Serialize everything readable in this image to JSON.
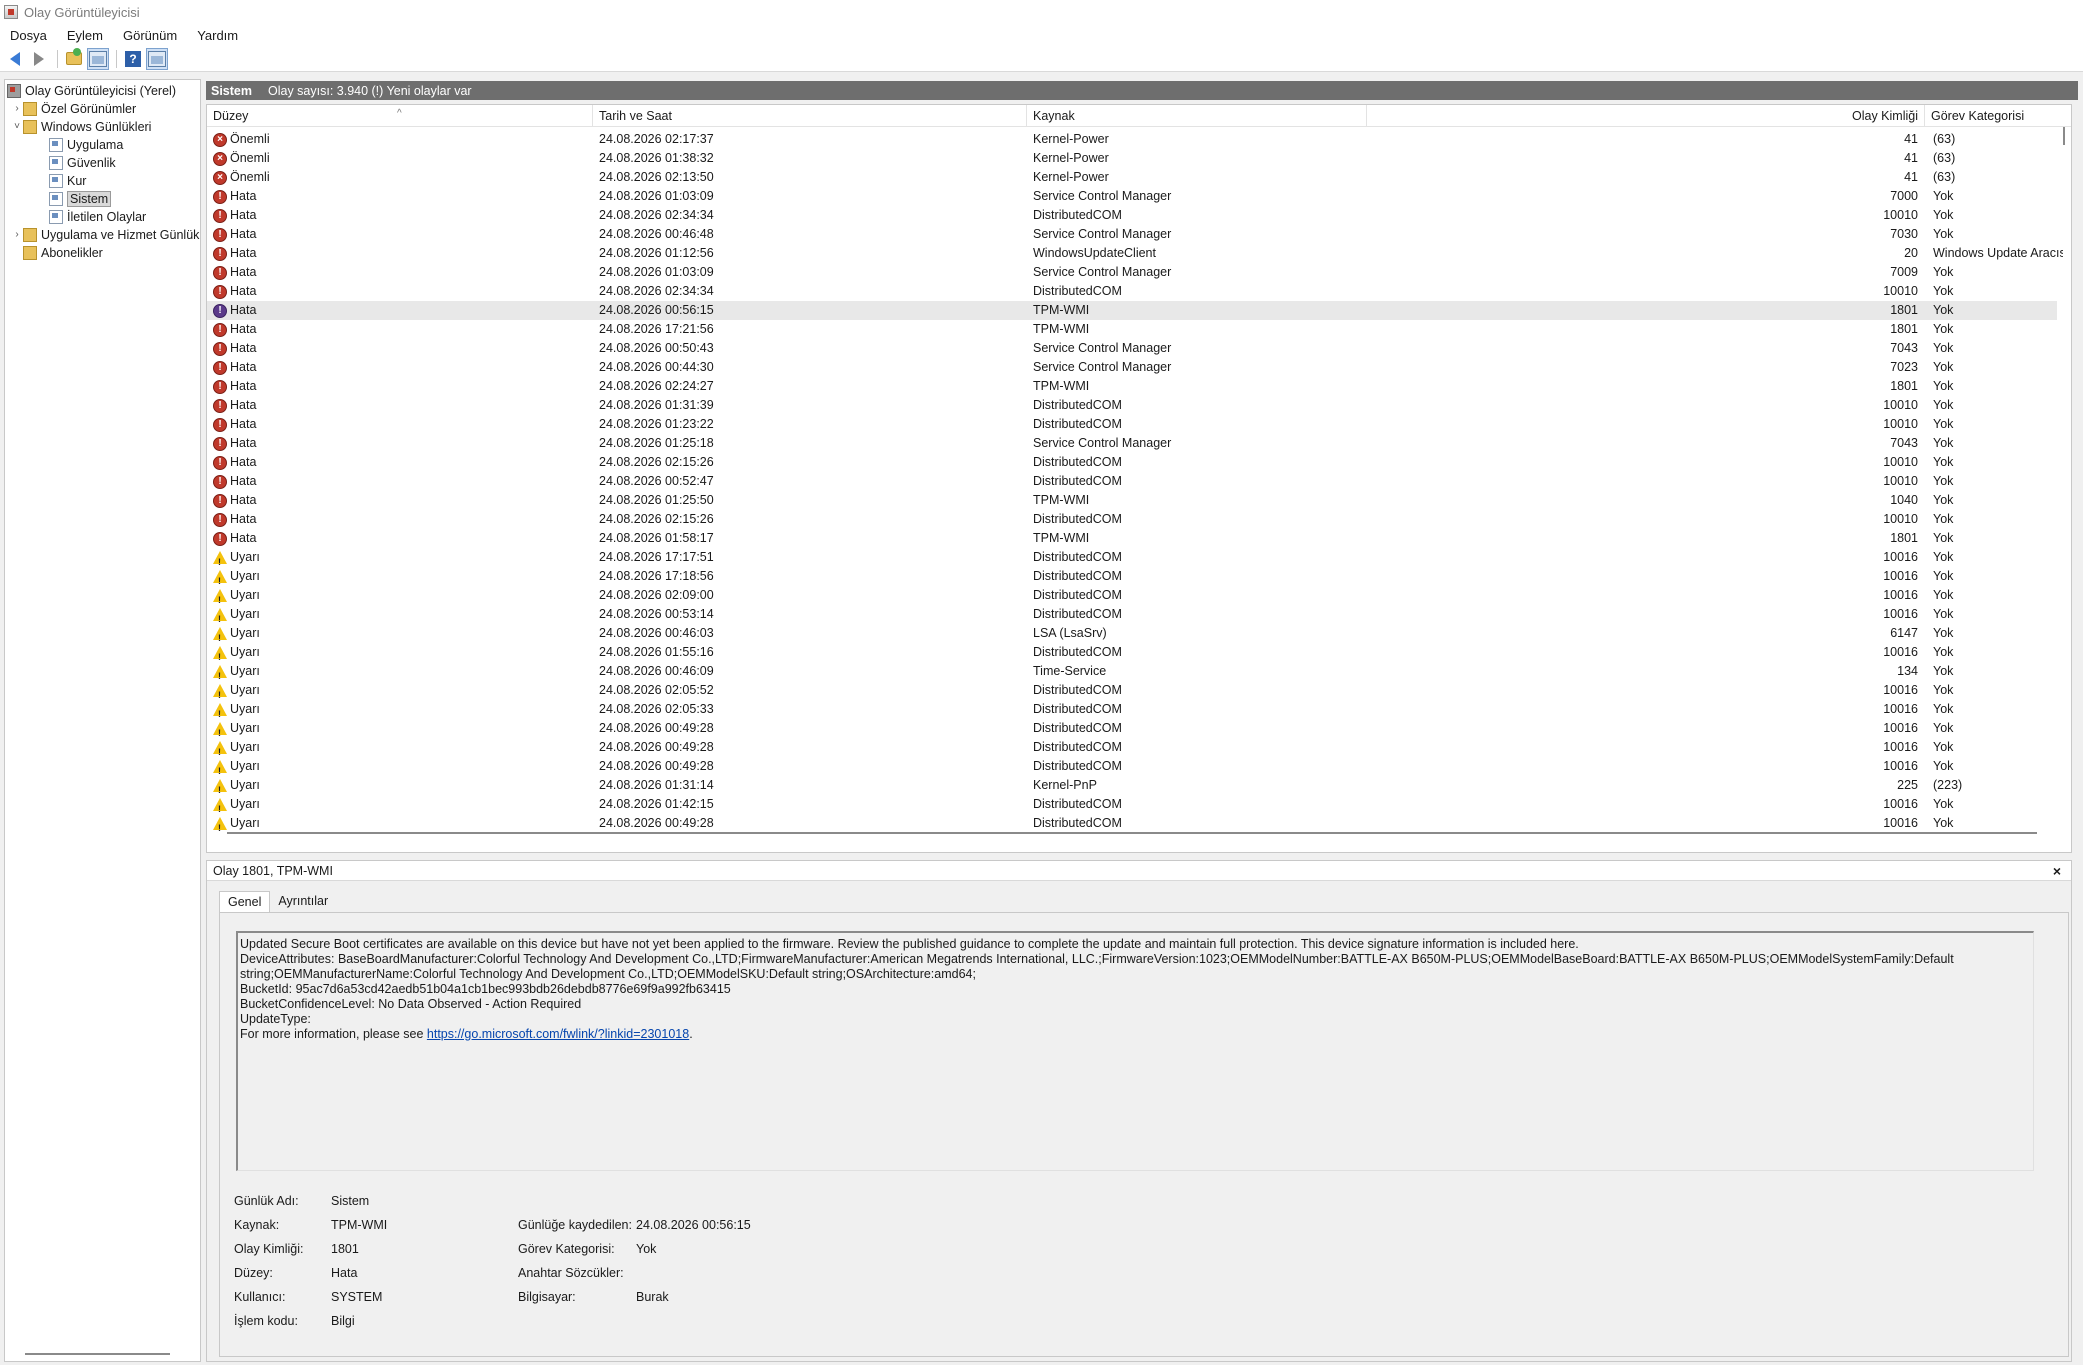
{
  "window": {
    "title": "Olay Görüntüleyicisi"
  },
  "menu": [
    "Dosya",
    "Eylem",
    "Görünüm",
    "Yardım"
  ],
  "tree": {
    "root": "Olay Görüntüleyicisi (Yerel)",
    "custom_views": "Özel Görünümler",
    "windows_logs": "Windows Günlükleri",
    "app": "Uygulama",
    "security": "Güvenlik",
    "setup": "Kur",
    "system": "Sistem",
    "forwarded": "İletilen Olaylar",
    "app_service": "Uygulama ve Hizmet Günlük",
    "subscriptions": "Abonelikler"
  },
  "main": {
    "title": "Sistem",
    "subtitle": "Olay sayısı: 3.940 (!) Yeni olaylar var",
    "columns": {
      "level": "Düzey",
      "date": "Tarih ve Saat",
      "source": "Kaynak",
      "id": "Olay Kimliği",
      "category": "Görev Kategorisi"
    }
  },
  "events": [
    {
      "level": "Önemli",
      "type": "critical",
      "date": "24.08.2026 02:17:37",
      "source": "Kernel-Power",
      "id": "41",
      "category": "(63)"
    },
    {
      "level": "Önemli",
      "type": "critical",
      "date": "24.08.2026 01:38:32",
      "source": "Kernel-Power",
      "id": "41",
      "category": "(63)"
    },
    {
      "level": "Önemli",
      "type": "critical",
      "date": "24.08.2026 02:13:50",
      "source": "Kernel-Power",
      "id": "41",
      "category": "(63)"
    },
    {
      "level": "Hata",
      "type": "error",
      "date": "24.08.2026 01:03:09",
      "source": "Service Control Manager",
      "id": "7000",
      "category": "Yok"
    },
    {
      "level": "Hata",
      "type": "error",
      "date": "24.08.2026 02:34:34",
      "source": "DistributedCOM",
      "id": "10010",
      "category": "Yok"
    },
    {
      "level": "Hata",
      "type": "error",
      "date": "24.08.2026 00:46:48",
      "source": "Service Control Manager",
      "id": "7030",
      "category": "Yok"
    },
    {
      "level": "Hata",
      "type": "error",
      "date": "24.08.2026 01:12:56",
      "source": "WindowsUpdateClient",
      "id": "20",
      "category": "Windows Update Aracısı"
    },
    {
      "level": "Hata",
      "type": "error",
      "date": "24.08.2026 01:03:09",
      "source": "Service Control Manager",
      "id": "7009",
      "category": "Yok"
    },
    {
      "level": "Hata",
      "type": "error",
      "date": "24.08.2026 02:34:34",
      "source": "DistributedCOM",
      "id": "10010",
      "category": "Yok"
    },
    {
      "level": "Hata",
      "type": "error",
      "date": "24.08.2026 00:56:15",
      "source": "TPM-WMI",
      "id": "1801",
      "category": "Yok",
      "selected": true
    },
    {
      "level": "Hata",
      "type": "error",
      "date": "24.08.2026 17:21:56",
      "source": "TPM-WMI",
      "id": "1801",
      "category": "Yok"
    },
    {
      "level": "Hata",
      "type": "error",
      "date": "24.08.2026 00:50:43",
      "source": "Service Control Manager",
      "id": "7043",
      "category": "Yok"
    },
    {
      "level": "Hata",
      "type": "error",
      "date": "24.08.2026 00:44:30",
      "source": "Service Control Manager",
      "id": "7023",
      "category": "Yok"
    },
    {
      "level": "Hata",
      "type": "error",
      "date": "24.08.2026 02:24:27",
      "source": "TPM-WMI",
      "id": "1801",
      "category": "Yok"
    },
    {
      "level": "Hata",
      "type": "error",
      "date": "24.08.2026 01:31:39",
      "source": "DistributedCOM",
      "id": "10010",
      "category": "Yok"
    },
    {
      "level": "Hata",
      "type": "error",
      "date": "24.08.2026 01:23:22",
      "source": "DistributedCOM",
      "id": "10010",
      "category": "Yok"
    },
    {
      "level": "Hata",
      "type": "error",
      "date": "24.08.2026 01:25:18",
      "source": "Service Control Manager",
      "id": "7043",
      "category": "Yok"
    },
    {
      "level": "Hata",
      "type": "error",
      "date": "24.08.2026 02:15:26",
      "source": "DistributedCOM",
      "id": "10010",
      "category": "Yok"
    },
    {
      "level": "Hata",
      "type": "error",
      "date": "24.08.2026 00:52:47",
      "source": "DistributedCOM",
      "id": "10010",
      "category": "Yok"
    },
    {
      "level": "Hata",
      "type": "error",
      "date": "24.08.2026 01:25:50",
      "source": "TPM-WMI",
      "id": "1040",
      "category": "Yok"
    },
    {
      "level": "Hata",
      "type": "error",
      "date": "24.08.2026 02:15:26",
      "source": "DistributedCOM",
      "id": "10010",
      "category": "Yok"
    },
    {
      "level": "Hata",
      "type": "error",
      "date": "24.08.2026 01:58:17",
      "source": "TPM-WMI",
      "id": "1801",
      "category": "Yok"
    },
    {
      "level": "Uyarı",
      "type": "warning",
      "date": "24.08.2026 17:17:51",
      "source": "DistributedCOM",
      "id": "10016",
      "category": "Yok"
    },
    {
      "level": "Uyarı",
      "type": "warning",
      "date": "24.08.2026 17:18:56",
      "source": "DistributedCOM",
      "id": "10016",
      "category": "Yok"
    },
    {
      "level": "Uyarı",
      "type": "warning",
      "date": "24.08.2026 02:09:00",
      "source": "DistributedCOM",
      "id": "10016",
      "category": "Yok"
    },
    {
      "level": "Uyarı",
      "type": "warning",
      "date": "24.08.2026 00:53:14",
      "source": "DistributedCOM",
      "id": "10016",
      "category": "Yok"
    },
    {
      "level": "Uyarı",
      "type": "warning",
      "date": "24.08.2026 00:46:03",
      "source": "LSA (LsaSrv)",
      "id": "6147",
      "category": "Yok"
    },
    {
      "level": "Uyarı",
      "type": "warning",
      "date": "24.08.2026 01:55:16",
      "source": "DistributedCOM",
      "id": "10016",
      "category": "Yok"
    },
    {
      "level": "Uyarı",
      "type": "warning",
      "date": "24.08.2026 00:46:09",
      "source": "Time-Service",
      "id": "134",
      "category": "Yok"
    },
    {
      "level": "Uyarı",
      "type": "warning",
      "date": "24.08.2026 02:05:52",
      "source": "DistributedCOM",
      "id": "10016",
      "category": "Yok"
    },
    {
      "level": "Uyarı",
      "type": "warning",
      "date": "24.08.2026 02:05:33",
      "source": "DistributedCOM",
      "id": "10016",
      "category": "Yok"
    },
    {
      "level": "Uyarı",
      "type": "warning",
      "date": "24.08.2026 00:49:28",
      "source": "DistributedCOM",
      "id": "10016",
      "category": "Yok"
    },
    {
      "level": "Uyarı",
      "type": "warning",
      "date": "24.08.2026 00:49:28",
      "source": "DistributedCOM",
      "id": "10016",
      "category": "Yok"
    },
    {
      "level": "Uyarı",
      "type": "warning",
      "date": "24.08.2026 00:49:28",
      "source": "DistributedCOM",
      "id": "10016",
      "category": "Yok"
    },
    {
      "level": "Uyarı",
      "type": "warning",
      "date": "24.08.2026 01:31:14",
      "source": "Kernel-PnP",
      "id": "225",
      "category": "(223)"
    },
    {
      "level": "Uyarı",
      "type": "warning",
      "date": "24.08.2026 01:42:15",
      "source": "DistributedCOM",
      "id": "10016",
      "category": "Yok"
    },
    {
      "level": "Uyarı",
      "type": "warning",
      "date": "24.08.2026 00:49:28",
      "source": "DistributedCOM",
      "id": "10016",
      "category": "Yok"
    }
  ],
  "detail": {
    "title": "Olay 1801, TPM-WMI",
    "close": "×",
    "tabs": [
      "Genel",
      "Ayrıntılar"
    ],
    "message_lines": [
      "Updated Secure Boot certificates are available on this device but have not yet been applied to the firmware. Review the published guidance to complete the update and maintain full protection. This device signature information is included here.",
      "DeviceAttributes: BaseBoardManufacturer:Colorful Technology And Development Co.,LTD;FirmwareManufacturer:American Megatrends International, LLC.;FirmwareVersion:1023;OEMModelNumber:BATTLE-AX B650M-PLUS;OEMModelBaseBoard:BATTLE-AX B650M-PLUS;OEMModelSystemFamily:Default",
      "string;OEMManufacturerName:Colorful Technology And Development Co.,LTD;OEMModelSKU:Default string;OSArchitecture:amd64;",
      "BucketId: 95ac7d6a53cd42aedb51b04a1cb1bec993bdb26debdb8776e69f9a992fb63415",
      "BucketConfidenceLevel: No Data Observed - Action Required",
      "UpdateType:"
    ],
    "more_info_prefix": "For more information, please see ",
    "more_info_link": "https://go.microsoft.com/fwlink/?linkid=2301018",
    "more_info_suffix": ".",
    "props": {
      "log_name_label": "Günlük Adı:",
      "log_name": "Sistem",
      "source_label": "Kaynak:",
      "source": "TPM-WMI",
      "logged_label": "Günlüğe kaydedilen:",
      "logged": "24.08.2026 00:56:15",
      "event_id_label": "Olay Kimliği:",
      "event_id": "1801",
      "task_label": "Görev Kategorisi:",
      "task": "Yok",
      "level_label": "Düzey:",
      "level": "Hata",
      "keywords_label": "Anahtar Sözcükler:",
      "keywords": "",
      "user_label": "Kullanıcı:",
      "user": "SYSTEM",
      "computer_label": "Bilgisayar:",
      "computer": "Burak",
      "opcode_label": "İşlem kodu:",
      "opcode": "Bilgi"
    }
  }
}
